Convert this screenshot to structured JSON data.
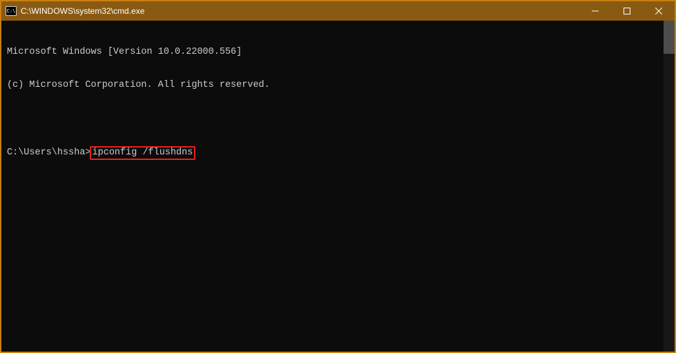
{
  "titlebar": {
    "icon_label": "C:\\",
    "title": "C:\\WINDOWS\\system32\\cmd.exe"
  },
  "terminal": {
    "line1": "Microsoft Windows [Version 10.0.22000.556]",
    "line2": "(c) Microsoft Corporation. All rights reserved.",
    "prompt_prefix": "C:\\Users\\hssha>",
    "highlighted_command": "ipconfig /flushdns"
  }
}
